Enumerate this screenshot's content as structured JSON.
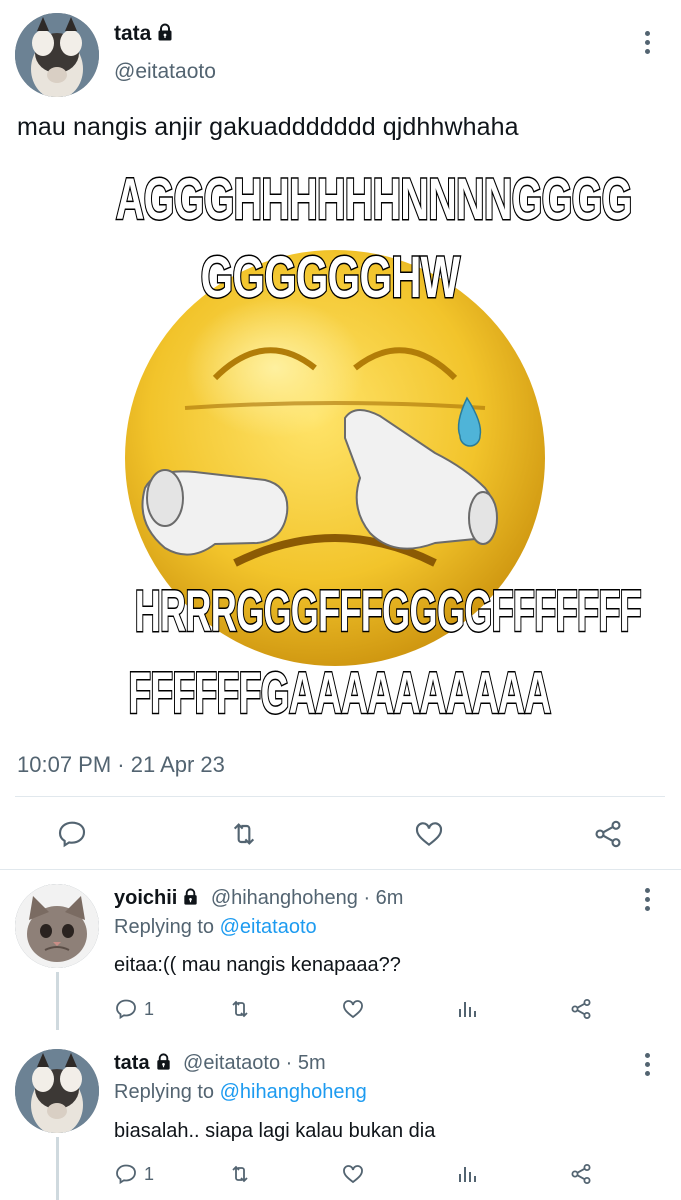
{
  "main_tweet": {
    "name": "tata",
    "handle": "@eitataoto",
    "text": "mau nangis anjir gakuaddddddd qjdhhwhaha",
    "timestamp": "10:07 PM · 21 Apr 23",
    "meme": {
      "line1": "AGGGHHHHHHNNNNGGGG",
      "line2": "GGGGGGHW",
      "line3": "HRRRGGGFFFGGGGFFFFFFF",
      "line4": "FFFFFFGAAAAAAAAAA"
    },
    "actions": [
      "reply-icon",
      "retweet-icon",
      "like-icon",
      "share-icon"
    ]
  },
  "replies": [
    {
      "name": "yoichii",
      "handle_time": "@hihanghoheng · 6m",
      "replying_prefix": "Replying to ",
      "replying_to": "@eitataoto",
      "text": "eitaa:(( mau nangis kenapaaa??",
      "reply_count": "1"
    },
    {
      "name": "tata",
      "handle_time": "@eitataoto · 5m",
      "replying_prefix": "Replying to ",
      "replying_to": "@hihanghoheng",
      "text": "biasalah.. siapa lagi kalau bukan dia",
      "reply_count": "1"
    }
  ],
  "colors": {
    "accent": "#1d9bf0",
    "secondary_text": "#536471",
    "primary_text": "#0f1419"
  }
}
